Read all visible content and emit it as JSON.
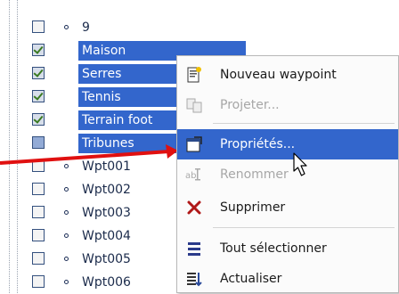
{
  "tree": {
    "items": [
      {
        "label": "9",
        "checked": false,
        "selected": false
      },
      {
        "label": "Maison",
        "checked": true,
        "selected": true
      },
      {
        "label": "Serres",
        "checked": true,
        "selected": true
      },
      {
        "label": "Tennis",
        "checked": true,
        "selected": true
      },
      {
        "label": "Terrain foot",
        "checked": true,
        "selected": true
      },
      {
        "label": "Tribunes",
        "checked": false,
        "selected": true
      },
      {
        "label": "Wpt001",
        "checked": false,
        "selected": false
      },
      {
        "label": "Wpt002",
        "checked": false,
        "selected": false
      },
      {
        "label": "Wpt003",
        "checked": false,
        "selected": false
      },
      {
        "label": "Wpt004",
        "checked": false,
        "selected": false
      },
      {
        "label": "Wpt005",
        "checked": false,
        "selected": false
      },
      {
        "label": "Wpt006",
        "checked": false,
        "selected": false
      }
    ]
  },
  "context_menu": {
    "items": [
      {
        "label": "Nouveau waypoint",
        "icon": "new-waypoint-icon",
        "disabled": false,
        "highlighted": false
      },
      {
        "label": "Projeter...",
        "icon": "project-icon",
        "disabled": true,
        "highlighted": false
      },
      {
        "label": "Propriétés...",
        "icon": "properties-icon",
        "disabled": false,
        "highlighted": true
      },
      {
        "label": "Renommer",
        "icon": "rename-icon",
        "disabled": true,
        "highlighted": false
      },
      {
        "label": "Supprimer",
        "icon": "delete-icon",
        "disabled": false,
        "highlighted": false
      },
      {
        "label": "Tout sélectionner",
        "icon": "select-all-icon",
        "disabled": false,
        "highlighted": false
      },
      {
        "label": "Actualiser",
        "icon": "refresh-icon",
        "disabled": false,
        "highlighted": false
      }
    ]
  },
  "colors": {
    "selection": "#3366cc",
    "arrow": "#e01010",
    "disabled_text": "#a7a7a7"
  }
}
